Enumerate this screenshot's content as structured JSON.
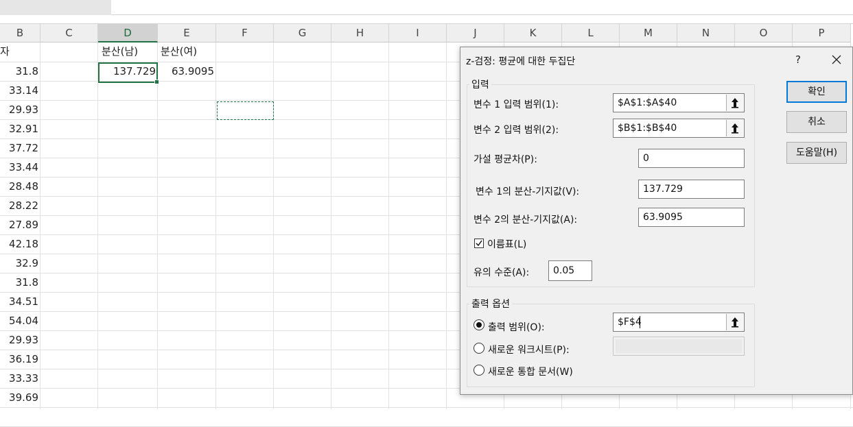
{
  "columns": [
    "B",
    "C",
    "D",
    "E",
    "F",
    "G",
    "H",
    "I",
    "J",
    "K",
    "L",
    "M",
    "N",
    "O",
    "P"
  ],
  "active_column": "D",
  "header_row": {
    "B": "자",
    "D": "분산(남)",
    "E": "분산(여)"
  },
  "row2": {
    "D": "137.729",
    "E": "63.9095"
  },
  "column_b_values": [
    "31.8",
    "33.14",
    "29.93",
    "32.91",
    "37.72",
    "33.44",
    "28.48",
    "28.22",
    "27.89",
    "42.18",
    "32.9",
    "31.8",
    "34.51",
    "54.04",
    "29.93",
    "36.19",
    "33.33",
    "39.69"
  ],
  "dialog": {
    "title": "z-검정: 평균에 대한 두집단",
    "help": "?",
    "input_group": "입력",
    "var1_range_label": "변수 1 입력 범위(1):",
    "var1_range_value": "$A$1:$A$40",
    "var2_range_label": "변수 2 입력 범위(2):",
    "var2_range_value": "$B$1:$B$40",
    "hyp_mean_label": "가설 평균차(P):",
    "hyp_mean_value": "0",
    "var1_variance_label": "변수 1의 분산-기지값(V):",
    "var1_variance_value": "137.729",
    "var2_variance_label": "변수 2의 분산-기지값(A):",
    "var2_variance_value": "63.9095",
    "labels_label": "이름표(L)",
    "labels_checked": true,
    "alpha_label": "유의 수준(A):",
    "alpha_value": "0.05",
    "output_group": "출력 옵션",
    "output_range_label": "출력 범위(O):",
    "output_range_value": "$F$4",
    "new_sheet_label": "새로운 워크시트(P):",
    "new_workbook_label": "새로운 통합 문서(W)",
    "ok_label": "확인",
    "cancel_label": "취소",
    "help_label": "도움말(H)"
  }
}
